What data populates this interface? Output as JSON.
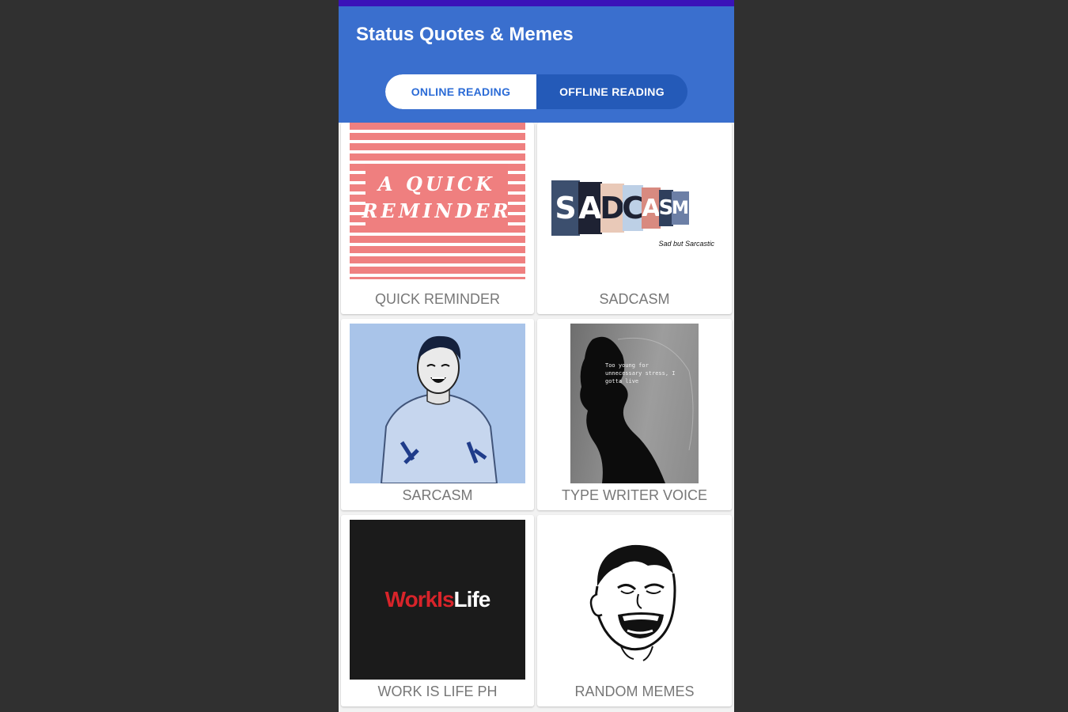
{
  "app": {
    "title": "Status Quotes & Memes"
  },
  "tabs": {
    "online_label": "ONLINE READING",
    "offline_label": "OFFLINE READING",
    "selected": "ONLINE READING"
  },
  "colors": {
    "status_bar": "#3a12b8",
    "app_bar": "#3a6fce",
    "tab_track": "#245ab8",
    "tab_active_text": "#2b6bd6",
    "label_text": "#777777"
  },
  "cards": [
    {
      "label": "QUICK REMINDER",
      "image_text": [
        "A QUICK",
        "REMINDER"
      ],
      "icon": "quick-reminder-image"
    },
    {
      "label": "SADCASM",
      "image_text": [
        "S",
        "A",
        "D",
        "C",
        "A",
        "S",
        "M"
      ],
      "image_subtext": "Sad but Sarcastic",
      "icon": "sadcasm-image"
    },
    {
      "label": "SARCASM",
      "icon": "laughing-man-image"
    },
    {
      "label": "TYPE WRITER VOICE",
      "image_text": "Too young for unnecessary stress, I gotta live",
      "icon": "typewriter-silhouette-image"
    },
    {
      "label": "WORK IS LIFE PH",
      "image_text": [
        "Work",
        "Is",
        "Life"
      ],
      "icon": "work-is-life-image"
    },
    {
      "label": "RANDOM MEMES",
      "icon": "troll-face-image"
    }
  ]
}
